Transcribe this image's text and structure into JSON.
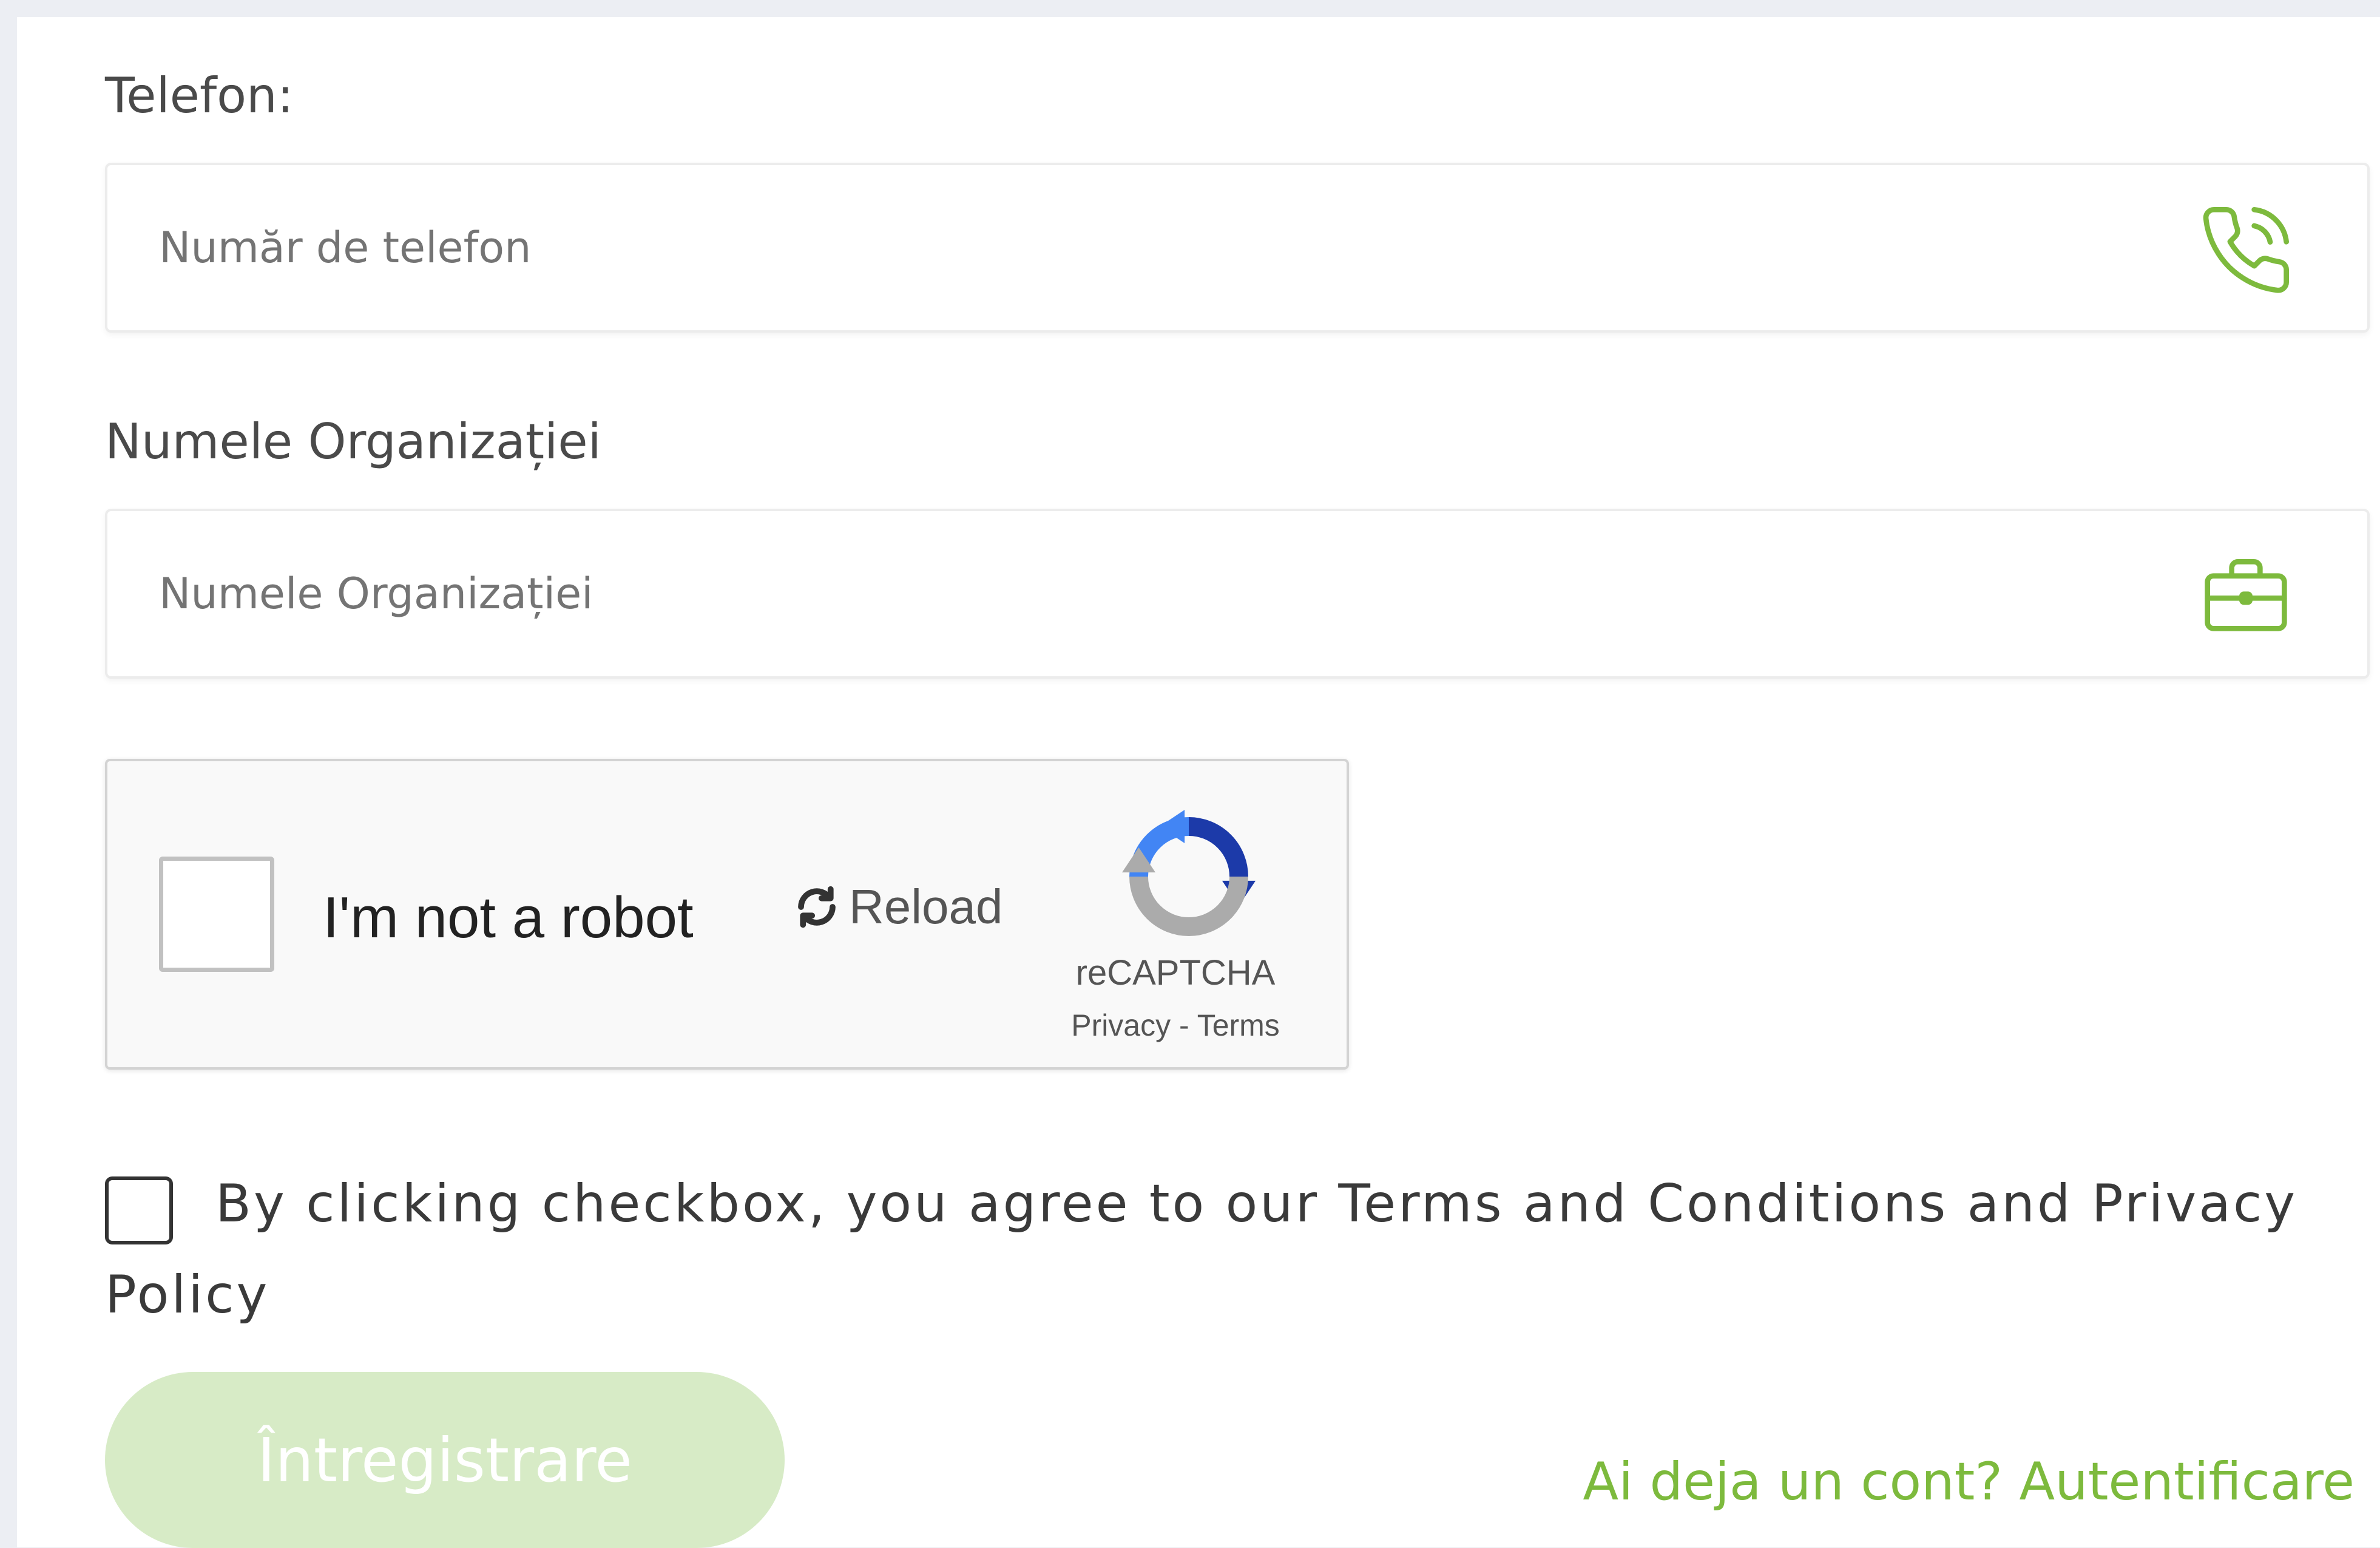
{
  "phone": {
    "label": "Telefon:",
    "placeholder": "Număr de telefon",
    "value": "",
    "icon": "phone-icon"
  },
  "organization": {
    "label": "Numele Organizației",
    "placeholder": "Numele Organizației",
    "value": "",
    "icon": "briefcase-icon"
  },
  "captcha": {
    "checkbox_label": "I'm not a robot",
    "reload_label": "Reload",
    "brand": "reCAPTCHA",
    "privacy_label": "Privacy",
    "separator": "-",
    "terms_label": "Terms"
  },
  "agreement": {
    "text": "By clicking checkbox, you agree to our Terms and Conditions and Privacy Policy",
    "checked": false
  },
  "actions": {
    "submit_label": "Întregistrare",
    "login_link_label": "Ai deja un cont? Autentificare"
  },
  "colors": {
    "accent": "#7DBA3D",
    "button_disabled": "#D7EBC6",
    "page_background": "#ECEEF3"
  }
}
